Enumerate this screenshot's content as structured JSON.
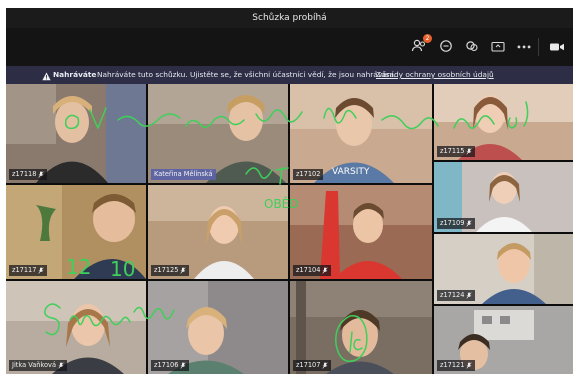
{
  "window": {
    "title": "Schůzka probíhá"
  },
  "toolbar": {
    "buttons": [
      {
        "name": "participants-button",
        "icon": "participants-icon",
        "badge": "2"
      },
      {
        "name": "chat-button",
        "icon": "chat-icon"
      },
      {
        "name": "reactions-button",
        "icon": "reactions-icon"
      },
      {
        "name": "share-screen-button",
        "icon": "share-screen-icon"
      },
      {
        "name": "more-actions-button",
        "icon": "more-icon",
        "label": "•••"
      },
      {
        "name": "camera-button",
        "icon": "camera-icon"
      }
    ]
  },
  "banner": {
    "bold": "Nahráváte",
    "message": "Nahráváte tuto schůzku. Ujistěte se, že všichni účastníci vědí, že jsou nahrávání.",
    "link": "Zásady ochrany osobních údajů"
  },
  "participants": [
    {
      "name": "z17118",
      "bg": "#8a7a6e"
    },
    {
      "name": "Kateřina Mělínská",
      "bg": "#9b8b7b"
    },
    {
      "name": "z17115",
      "bg": "#c9a98f"
    },
    {
      "name": "z17102",
      "bg": "#a59a8c"
    },
    {
      "name": "z17109",
      "bg": "#c8c1be"
    },
    {
      "name": "z17117",
      "bg": "#b09060"
    },
    {
      "name": "z17125",
      "bg": "#b89a7c"
    },
    {
      "name": "z17104",
      "bg": "#9a6a55"
    },
    {
      "name": "z17124",
      "bg": "#d5cfc6"
    },
    {
      "name": "Jitka Vaňková",
      "bg": "#b8aca0"
    },
    {
      "name": "z17106",
      "bg": "#8e8a8c"
    },
    {
      "name": "z17107",
      "bg": "#7a6e63"
    },
    {
      "name": "z17121",
      "bg": "#a9a6a6"
    }
  ],
  "annotations": {
    "color": "#3fcf5a",
    "texts": [
      "12",
      "10",
      "OBĚD"
    ]
  }
}
